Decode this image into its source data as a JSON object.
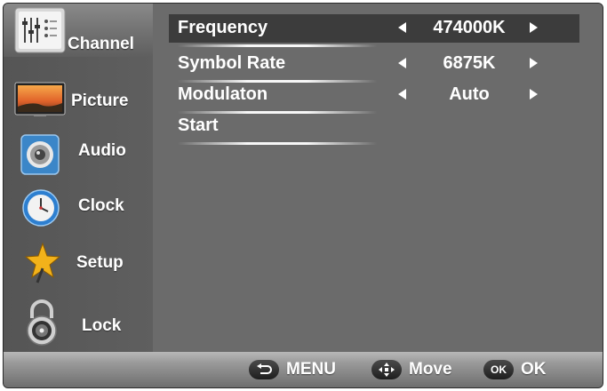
{
  "sidebar": {
    "items": [
      {
        "label": "Channel",
        "icon": "channel-sliders-icon",
        "active": true
      },
      {
        "label": "Picture",
        "icon": "tv-screen-icon"
      },
      {
        "label": "Audio",
        "icon": "speaker-icon"
      },
      {
        "label": "Clock",
        "icon": "clock-icon"
      },
      {
        "label": "Setup",
        "icon": "star-icon"
      },
      {
        "label": "Lock",
        "icon": "padlock-icon"
      }
    ]
  },
  "menu": {
    "rows": [
      {
        "label": "Frequency",
        "value": "474000K",
        "selected": true
      },
      {
        "label": "Symbol Rate",
        "value": "6875K"
      },
      {
        "label": "Modulaton",
        "value": "Auto"
      },
      {
        "label": "Start"
      }
    ]
  },
  "footer": {
    "menu_label": "MENU",
    "move_label": "Move",
    "ok_badge": "OK",
    "ok_label": "OK"
  },
  "colors": {
    "panel": "#6b6b6b",
    "sidebar": "#5a5a5a",
    "selected_row": "#3c3c3c",
    "text": "#ffffff"
  }
}
